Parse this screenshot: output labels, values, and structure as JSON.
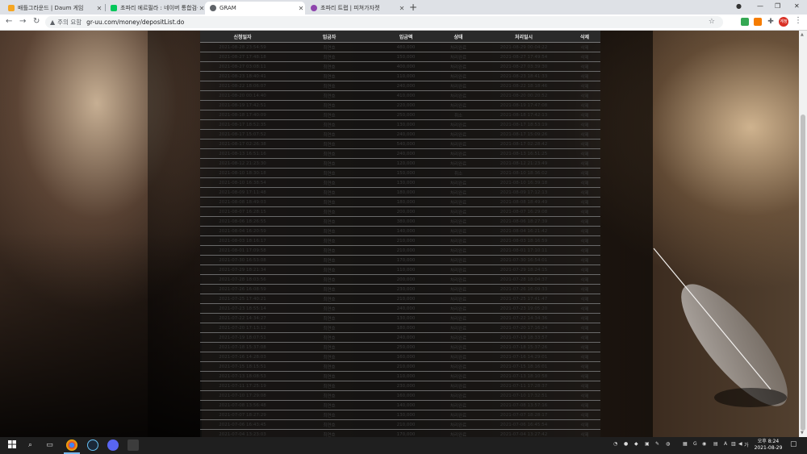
{
  "browser": {
    "tabs": [
      {
        "label": "배틀그라운드 | Daum 게임",
        "active": false,
        "icon_color": "#f5a623"
      },
      {
        "label": "초파리 에르필라 : 네이버 통합검색",
        "active": false,
        "icon_color": "#03c75a"
      },
      {
        "label": "GRAM",
        "active": true,
        "icon_color": "#5f6368"
      },
      {
        "label": "초파리 트랩 | 피쳐가자켓",
        "active": false,
        "icon_color": "#8e44ad"
      }
    ],
    "new_tab": "+",
    "window_controls": {
      "menu": "●",
      "minimize": "—",
      "maximize": "❐",
      "close": "✕"
    },
    "nav": {
      "back": "←",
      "forward": "→",
      "reload": "↻"
    },
    "security_icon": "warning-triangle-icon",
    "security_label": "주의 요함",
    "url": "gr-uu.com/money/depositList.do",
    "bookmark_icon": "star-icon",
    "extensions": [
      {
        "name": "ext-green",
        "color": "#34a853"
      },
      {
        "name": "ext-orange",
        "color": "#f57c00"
      },
      {
        "name": "puzzle",
        "color": "#5f6368"
      }
    ],
    "profile_label": "계정",
    "menu_label": "⋮"
  },
  "table": {
    "headers": [
      "신청일자",
      "입금자",
      "입금액",
      "상태",
      "처리일시",
      "삭제"
    ],
    "rows": [
      [
        "2021-08-28 23:54:59",
        "최연호",
        "480,000",
        "처리완료",
        "2021-08-29 00:04:22",
        "삭제"
      ],
      [
        "2021-08-27 17:48:18",
        "최연호",
        "150,000",
        "처리완료",
        "2021-08-27 17:49:54",
        "삭제"
      ],
      [
        "2021-08-27 03:08:11",
        "최연호",
        "400,000",
        "처리완료",
        "2021-08-27 03:39:30",
        "삭제"
      ],
      [
        "2021-08-23 18:40:41",
        "최연호",
        "110,000",
        "처리완료",
        "2021-08-23 18:41:33",
        "삭제"
      ],
      [
        "2021-08-22 18:06:07",
        "최연호",
        "240,000",
        "처리완료",
        "2021-08-22 18:18:46",
        "삭제"
      ],
      [
        "2021-08-20 00:14:40",
        "최연호",
        "410,000",
        "처리완료",
        "2021-08-20 00:20:52",
        "삭제"
      ],
      [
        "2021-08-19 17:42:51",
        "최연호",
        "220,000",
        "처리완료",
        "2021-08-19 17:47:08",
        "삭제"
      ],
      [
        "2021-08-18 17:40:09",
        "최연호",
        "250,000",
        "취소",
        "2021-08-18 17:42:13",
        "삭제"
      ],
      [
        "2021-08-17 18:52:35",
        "최연호",
        "130,000",
        "처리완료",
        "2021-08-17 18:53:19",
        "삭제"
      ],
      [
        "2021-08-17 15:07:52",
        "최연호",
        "240,000",
        "처리완료",
        "2021-08-17 15:09:26",
        "삭제"
      ],
      [
        "2021-08-17 02:26:38",
        "최연호",
        "540,000",
        "처리완료",
        "2021-08-17 02:28:42",
        "삭제"
      ],
      [
        "2021-08-13 16:51:16",
        "최연호",
        "240,000",
        "처리완료",
        "2021-08-13 16:51:25",
        "삭제"
      ],
      [
        "2021-08-12 21:23:30",
        "최연호",
        "120,000",
        "처리완료",
        "2021-08-12 21:23:49",
        "삭제"
      ],
      [
        "2021-08-10 18:30:18",
        "최연호",
        "150,000",
        "취소",
        "2021-08-10 18:36:02",
        "삭제"
      ],
      [
        "2021-08-10 16:38:54",
        "최연호",
        "130,000",
        "처리완료",
        "2021-08-10 16:39:18",
        "삭제"
      ],
      [
        "2021-08-09 17:11:48",
        "최연호",
        "180,000",
        "처리완료",
        "2021-08-09 17:12:13",
        "삭제"
      ],
      [
        "2021-08-08 18:49:03",
        "최연호",
        "180,000",
        "처리완료",
        "2021-08-08 18:49:49",
        "삭제"
      ],
      [
        "2021-08-07 16:28:15",
        "최연호",
        "200,000",
        "처리완료",
        "2021-08-07 16:29:08",
        "삭제"
      ],
      [
        "2021-08-06 18:26:55",
        "최연호",
        "380,000",
        "처리완료",
        "2021-08-06 18:27:39",
        "삭제"
      ],
      [
        "2021-08-04 16:20:59",
        "최연호",
        "140,000",
        "처리완료",
        "2021-08-04 16:21:42",
        "삭제"
      ],
      [
        "2021-08-03 18:16:17",
        "최연호",
        "210,000",
        "처리완료",
        "2021-08-03 18:16:59",
        "삭제"
      ],
      [
        "2021-08-01 17:09:58",
        "최연호",
        "210,000",
        "처리완료",
        "2021-08-01 17:10:11",
        "삭제"
      ],
      [
        "2021-07-30 16:53:08",
        "최연호",
        "170,000",
        "처리완료",
        "2021-07-30 16:54:01",
        "삭제"
      ],
      [
        "2021-07-29 18:21:34",
        "최연호",
        "110,000",
        "처리완료",
        "2021-07-29 18:24:15",
        "삭제"
      ],
      [
        "2021-07-28 18:03:56",
        "최연호",
        "200,000",
        "처리완료",
        "2021-07-28 18:04:37",
        "삭제"
      ],
      [
        "2021-07-26 16:08:59",
        "최연호",
        "230,000",
        "처리완료",
        "2021-07-26 16:09:33",
        "삭제"
      ],
      [
        "2021-07-25 17:40:21",
        "최연호",
        "210,000",
        "처리완료",
        "2021-07-25 17:41:47",
        "삭제"
      ],
      [
        "2021-07-23 18:55:14",
        "최연호",
        "240,000",
        "처리완료",
        "2021-07-23 19:05:20",
        "삭제"
      ],
      [
        "2021-07-22 14:34:27",
        "최연호",
        "130,000",
        "처리완료",
        "2021-07-22 14:34:36",
        "삭제"
      ],
      [
        "2021-07-20 17:13:12",
        "최연호",
        "180,000",
        "처리완료",
        "2021-07-20 17:16:24",
        "삭제"
      ],
      [
        "2021-07-19 18:07:51",
        "최연호",
        "240,000",
        "처리완료",
        "2021-07-19 18:33:57",
        "삭제"
      ],
      [
        "2021-07-18 15:37:08",
        "최연호",
        "250,000",
        "처리완료",
        "2021-07-18 15:37:26",
        "삭제"
      ],
      [
        "2021-07-16 14:28:03",
        "최연호",
        "160,000",
        "처리완료",
        "2021-07-16 14:29:01",
        "삭제"
      ],
      [
        "2021-07-15 18:15:51",
        "최연호",
        "210,000",
        "처리완료",
        "2021-07-15 18:16:01",
        "삭제"
      ],
      [
        "2021-07-13 18:08:53",
        "최연호",
        "110,000",
        "처리완료",
        "2021-07-13 18:10:58",
        "삭제"
      ],
      [
        "2021-07-11 17:25:19",
        "최연호",
        "230,000",
        "처리완료",
        "2021-07-11 17:28:37",
        "삭제"
      ],
      [
        "2021-07-10 17:29:08",
        "최연호",
        "160,000",
        "처리완료",
        "2021-07-10 17:32:51",
        "삭제"
      ],
      [
        "2021-07-08 13:56:48",
        "최연호",
        "140,000",
        "처리완료",
        "2021-07-08 13:57:16",
        "삭제"
      ],
      [
        "2021-07-07 18:27:29",
        "최연호",
        "130,000",
        "처리완료",
        "2021-07-07 18:28:17",
        "삭제"
      ],
      [
        "2021-07-06 16:43:45",
        "최연호",
        "210,000",
        "처리완료",
        "2021-07-06 16:45:54",
        "삭제"
      ],
      [
        "2021-07-04 13:23:03",
        "최연호",
        "170,000",
        "처리완료",
        "2021-07-04 13:27:42",
        "삭제"
      ]
    ]
  },
  "taskbar": {
    "start_icon": "windows-start-icon",
    "search_icon": "search-icon",
    "taskview_icon": "task-view-icon",
    "apps": [
      {
        "name": "chrome",
        "color": "#db4437"
      },
      {
        "name": "steam",
        "color": "#1b2838"
      },
      {
        "name": "discord",
        "color": "#5865f2"
      },
      {
        "name": "app",
        "color": "#3c3c3c"
      }
    ],
    "tray_keyboard": "A",
    "tray_lang": "가",
    "clock_time": "오후 8:24",
    "clock_date": "2021-08-29"
  }
}
